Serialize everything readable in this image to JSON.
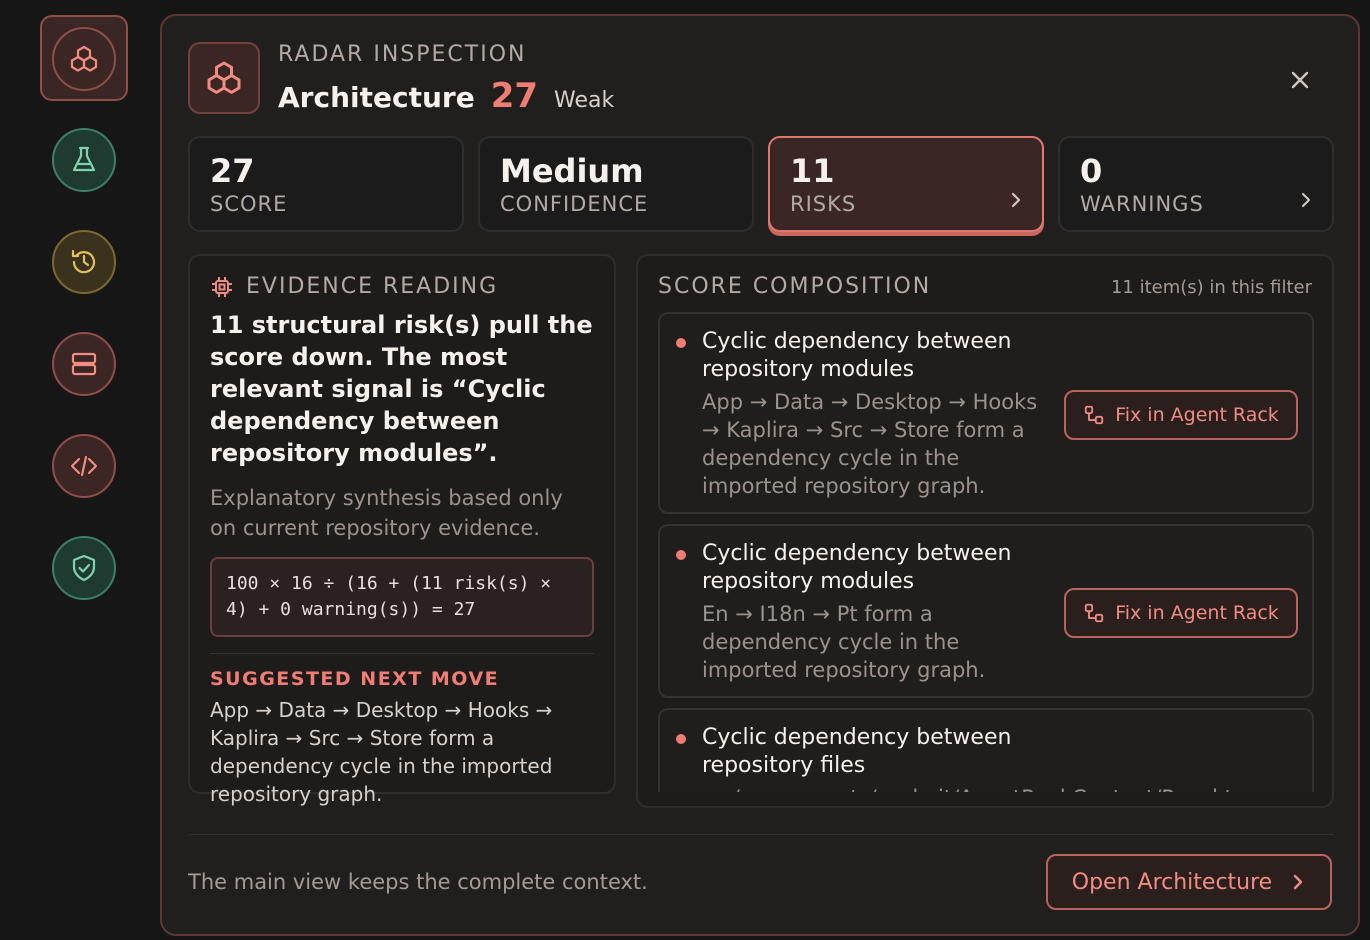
{
  "rail": {
    "items": [
      {
        "icon": "cubes-icon",
        "color": "#f08c82",
        "active": true
      },
      {
        "icon": "flask-icon",
        "color": "#7fd3ae"
      },
      {
        "icon": "history-icon",
        "color": "#e2c15e"
      },
      {
        "icon": "server-icon",
        "color": "#f08c82"
      },
      {
        "icon": "code-icon",
        "color": "#f08c82"
      },
      {
        "icon": "shield-check-icon",
        "color": "#7fd3ae"
      }
    ]
  },
  "header": {
    "eyebrow": "RADAR INSPECTION",
    "title": "Architecture",
    "score": "27",
    "grade": "Weak",
    "icon": "cubes-icon"
  },
  "stats": [
    {
      "value": "27",
      "label": "SCORE"
    },
    {
      "value": "Medium",
      "label": "CONFIDENCE"
    },
    {
      "value": "11",
      "label": "RISKS",
      "active": true
    },
    {
      "value": "0",
      "label": "WARNINGS"
    }
  ],
  "evidence": {
    "title": "EVIDENCE READING",
    "main": "11 structural risk(s) pull the score down. The most relevant signal is “Cyclic dependency between repository modules”.",
    "sub": "Explanatory synthesis based only on current repository evidence.",
    "formula": "100 × 16 ÷ (16 + (11 risk(s) × 4) + 0 warning(s)) = 27",
    "move_label": "SUGGESTED NEXT MOVE",
    "move_text": "App → Data → Desktop → Hooks → Kaplira → Src → Store form a dependency cycle in the imported repository graph."
  },
  "composition": {
    "title": "SCORE COMPOSITION",
    "count": "11 item(s) in this filter",
    "items": [
      {
        "title": "Cyclic dependency between repository modules",
        "desc": "App → Data → Desktop → Hooks → Kaplira → Src → Store form a dependency cycle in the imported repository graph.",
        "action": "Fix in Agent Rack"
      },
      {
        "title": "Cyclic dependency between repository modules",
        "desc": "En → I18n → Pt form a dependency cycle in the imported repository graph.",
        "action": "Fix in Agent Rack"
      },
      {
        "title": "Cyclic dependency between repository files",
        "desc": "src/components/cockpit/AgentRackContext/Panel.tsx",
        "action": ""
      }
    ]
  },
  "footer": {
    "text": "The main view keeps the complete context.",
    "button": "Open Architecture"
  }
}
